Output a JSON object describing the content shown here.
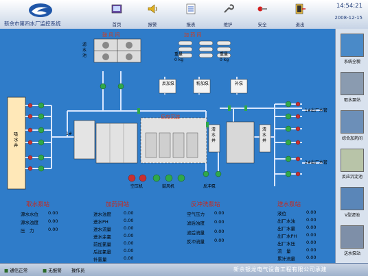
{
  "header": {
    "title": "新余市第四水厂监控系统",
    "time": "14:54:21",
    "date": "2008-12-15"
  },
  "toolbar": [
    {
      "label": "首页",
      "icon": "home-icon"
    },
    {
      "label": "报警",
      "icon": "speaker-icon"
    },
    {
      "label": "报表",
      "icon": "report-icon"
    },
    {
      "label": "维护",
      "icon": "wrench-icon"
    },
    {
      "label": "安全",
      "icon": "key-icon"
    },
    {
      "label": "退出",
      "icon": "exit-icon"
    }
  ],
  "sidebar": [
    {
      "label": "系统全貌"
    },
    {
      "label": "取水泵站"
    },
    {
      "label": "综合加药间"
    },
    {
      "label": "反应沉淀池"
    },
    {
      "label": "V型滤池"
    },
    {
      "label": "送水泵站"
    }
  ],
  "diagram": {
    "blower_room": "鼓 风 间",
    "dosing_room": "加 药 间",
    "intake_well": "吸 水 井",
    "reaction_tank": "反应沉淀",
    "clear_well_1": "清 水 井",
    "clear_well_2": "清 水 井",
    "filter_pool": "滤 水 池",
    "weight": "重量",
    "weight_unit": "0 kg",
    "dose_tanks": [
      "反加泵",
      "粉加泵",
      "补泵"
    ],
    "valve": "1#",
    "pumps_small": [
      "空压机",
      "鼓风机",
      "反冲泵"
    ],
    "outlet": "出厂水管",
    "outlets": [
      "1#出厂水管",
      "2#出厂水管"
    ]
  },
  "sections": [
    {
      "title": "取水泵站",
      "params": [
        {
          "name": "源水水位",
          "value": "0.00"
        },
        {
          "name": "源水浊度",
          "value": "0.00"
        },
        {
          "name": "压　力",
          "value": "0.00"
        }
      ]
    },
    {
      "title": "加药间站",
      "params": [
        {
          "name": "进水浊度",
          "value": "0.00"
        },
        {
          "name": "进水PH",
          "value": "0.00"
        },
        {
          "name": "进水流量",
          "value": "0.00"
        },
        {
          "name": "进水余氯",
          "value": "0.00"
        },
        {
          "name": "前加氯量",
          "value": "0.00"
        },
        {
          "name": "后加氯量",
          "value": "0.00"
        },
        {
          "name": "补氯量",
          "value": "0.00"
        }
      ]
    },
    {
      "title": "反冲洗泵站",
      "params": [
        {
          "name": "空气压力",
          "value": "0.00"
        },
        {
          "name": "滤后浊度",
          "value": "0.00"
        },
        {
          "name": "滤后流量",
          "value": "0.00"
        },
        {
          "name": "反冲流量",
          "value": "0.00"
        }
      ]
    },
    {
      "title": "送水泵站",
      "params": [
        {
          "name": "液位",
          "value": "0.00"
        },
        {
          "name": "出厂水浊",
          "value": "0.00"
        },
        {
          "name": "出厂水量",
          "value": "0.00"
        },
        {
          "name": "出厂水PH",
          "value": "0.00"
        },
        {
          "name": "出厂水压",
          "value": "0.00"
        },
        {
          "name": "流　量",
          "value": "0.00"
        },
        {
          "name": "累计流量",
          "value": "0.00"
        }
      ]
    }
  ],
  "status": {
    "item1": "通信正常",
    "item2": "无报警",
    "item3": "操作员",
    "company": "新余银龙电气设备工程有限公司承建"
  }
}
